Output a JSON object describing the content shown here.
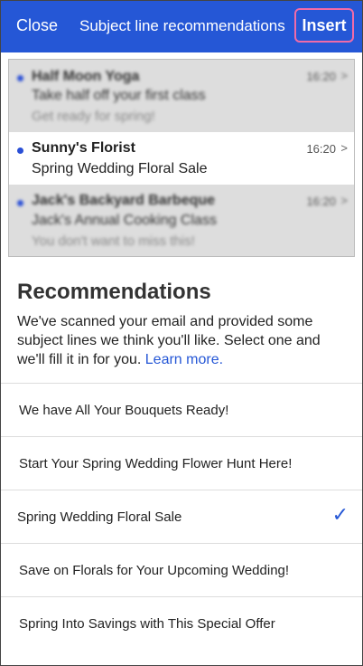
{
  "topbar": {
    "close_label": "Close",
    "title": "Subject line recommendations",
    "insert_label": "Insert"
  },
  "preview": {
    "messages": [
      {
        "sender": "Half Moon Yoga",
        "subject": "Take half off your first class",
        "snippet": "Get ready for spring!",
        "time": "16:20",
        "unread": true
      },
      {
        "sender": "Sunny's Florist",
        "subject": "Spring Wedding Floral Sale",
        "time": "16:20",
        "unread": true
      },
      {
        "sender": "Jack's Backyard Barbeque",
        "subject": "Jack's Annual Cooking Class",
        "snippet": "You don't want to miss this!",
        "time": "16:20",
        "unread": true
      }
    ]
  },
  "recommendations": {
    "heading": "Recommendations",
    "description": "We've scanned your email and provided some subject lines we think you'll like. Select one and we'll fill it in for you.",
    "learn_more": "Learn more.",
    "options": [
      {
        "label": "We have All Your Bouquets Ready!"
      },
      {
        "label": "Start Your Spring Wedding Flower Hunt Here!"
      },
      {
        "label": "Spring Wedding Floral Sale",
        "selected": true
      },
      {
        "label": "Save on Florals for Your Upcoming Wedding!"
      },
      {
        "label": "Spring Into Savings with This Special Offer"
      }
    ]
  },
  "icons": {
    "chevron": "chevron-right-icon",
    "check": "checkmark-icon",
    "unread": "unread-dot-icon"
  },
  "colors": {
    "header_bg": "#2557d6",
    "insert_highlight": "#f06ba8",
    "link": "#2557d6",
    "unread_dot": "#2a4fd6"
  }
}
